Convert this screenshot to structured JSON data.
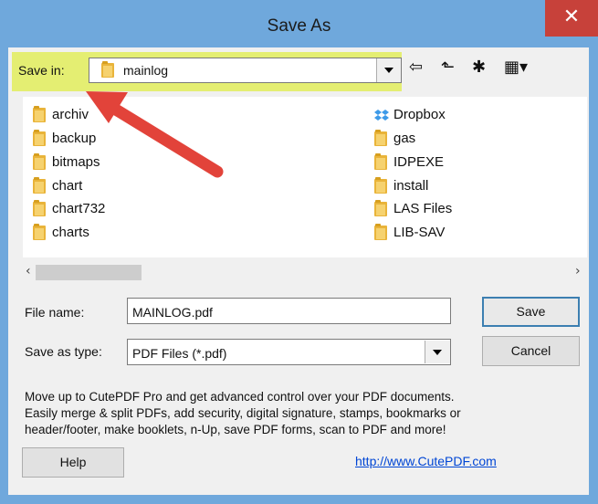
{
  "window": {
    "title": "Save As",
    "close_glyph": "✕"
  },
  "save_in": {
    "label": "Save in:",
    "value": "mainlog"
  },
  "toolbar": [
    {
      "name": "back-icon",
      "glyph": "⇦"
    },
    {
      "name": "up-folder-icon",
      "glyph": "⬑"
    },
    {
      "name": "new-folder-icon",
      "glyph": "✱"
    },
    {
      "name": "view-menu-icon",
      "glyph": "▦▾"
    }
  ],
  "files_left": [
    "archiv",
    "backup",
    "bitmaps",
    "chart",
    "chart732",
    "charts"
  ],
  "files_right": [
    "Dropbox",
    "gas",
    "IDPEXE",
    "install",
    "LAS Files",
    "LIB-SAV"
  ],
  "scroll": {
    "left": "‹",
    "right": "›"
  },
  "file_name": {
    "label": "File name:",
    "value": "MAINLOG.pdf"
  },
  "save_as_type": {
    "label": "Save as type:",
    "value": "PDF Files (*.pdf)"
  },
  "buttons": {
    "save": "Save",
    "cancel": "Cancel",
    "help": "Help"
  },
  "promo": [
    "Move up to CutePDF Pro and get advanced control over your PDF documents.",
    "Easily merge & split PDFs, add security, digital signature, stamps, bookmarks or",
    "header/footer, make booklets, n-Up, save PDF forms, scan to PDF and more!"
  ],
  "link": "http://www.CutePDF.com",
  "colors": {
    "titlebar": "#6fa8dc",
    "close": "#c7413a",
    "highlight": "#e4ee72",
    "arrow": "#e2433a",
    "link": "#0046d5"
  }
}
